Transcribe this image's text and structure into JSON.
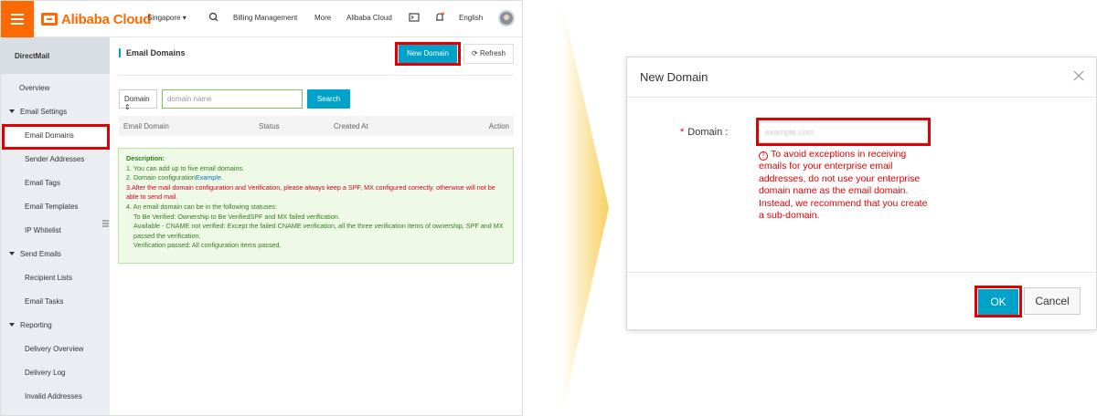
{
  "topbar": {
    "brand": "Alibaba Cloud",
    "region": "Singapore",
    "billing": "Billing Management",
    "more": "More",
    "alibaba_cloud": "Alibaba Cloud",
    "language": "English"
  },
  "sidebar": {
    "title": "DirectMail",
    "overview": "Overview",
    "groups": [
      {
        "label": "Email Settings",
        "items": [
          "Email Domains",
          "Sender Addresses",
          "Email Tags",
          "Email Templates",
          "IP Whitelist"
        ]
      },
      {
        "label": "Send Emails",
        "items": [
          "Recipient Lists",
          "Email Tasks"
        ]
      },
      {
        "label": "Reporting",
        "items": [
          "Delivery Overview",
          "Delivery Log",
          "Invalid Addresses"
        ]
      }
    ]
  },
  "main": {
    "title": "Email Domains",
    "new_domain": "New Domain",
    "refresh": "Refresh",
    "filter_select": "Domain",
    "search_placeholder": "domain name",
    "search": "Search",
    "columns": [
      "Email Domain",
      "Status",
      "Created At",
      "Action"
    ],
    "description": {
      "heading": "Description:",
      "line1": "1. You can add up to five email domains.",
      "line2_prefix": "2. Domain configuration",
      "line2_link": "Example.",
      "line3": "3.After the mail domain configuration and Verification,  please always keep a SPF, MX configured correctly, otherwise will not be able to send mail.",
      "line4": "4. An email domain can be in the following statuses:",
      "status1": "To Be Verified: Ownership to Be VerifiedSPF and MX failed verification.",
      "status2": "Available - CNAME not verified: Except the failed CNAME verification, all the three verification items of ownership, SPF and MX passed the verification.",
      "status3": "Verification passed: All configuration items passed."
    }
  },
  "dialog": {
    "title": "New Domain",
    "domain_label": "Domain :",
    "domain_value": "example.com",
    "error": "To avoid exceptions in receiving emails for your enterprise email addresses, do not use your enterprise domain name as the email domain. Instead, we recommend that you create a sub-domain.",
    "ok": "OK",
    "cancel": "Cancel"
  },
  "colors": {
    "brand_orange": "#ff6a00",
    "primary_blue": "#00a2ca",
    "highlight_red": "#e00000",
    "arrow_yellow": "#f7c948"
  }
}
